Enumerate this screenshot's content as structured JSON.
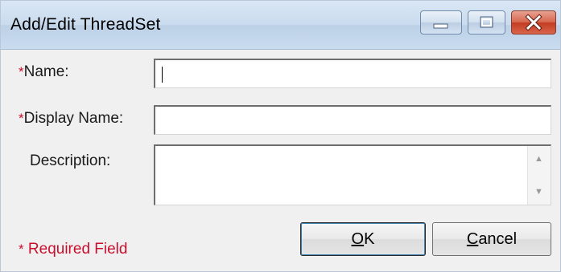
{
  "window": {
    "title": "Add/Edit ThreadSet",
    "controls": {
      "minimize": "minimize-icon",
      "maximize": "maximize-icon",
      "close": "close-icon"
    }
  },
  "form": {
    "required_marker": "*",
    "name_label": "Name:",
    "name_value": "",
    "display_name_label": "Display Name:",
    "display_name_value": "",
    "description_label": "Description:",
    "description_value": ""
  },
  "footer": {
    "required_marker": "*",
    "required_note": " Required Field",
    "ok_mnemonic": "O",
    "ok_rest": "K",
    "cancel_mnemonic": "C",
    "cancel_rest": "ancel"
  },
  "colors": {
    "required": "#c8102e",
    "titlebar": "#c9dbee",
    "close_button": "#c23c22"
  }
}
